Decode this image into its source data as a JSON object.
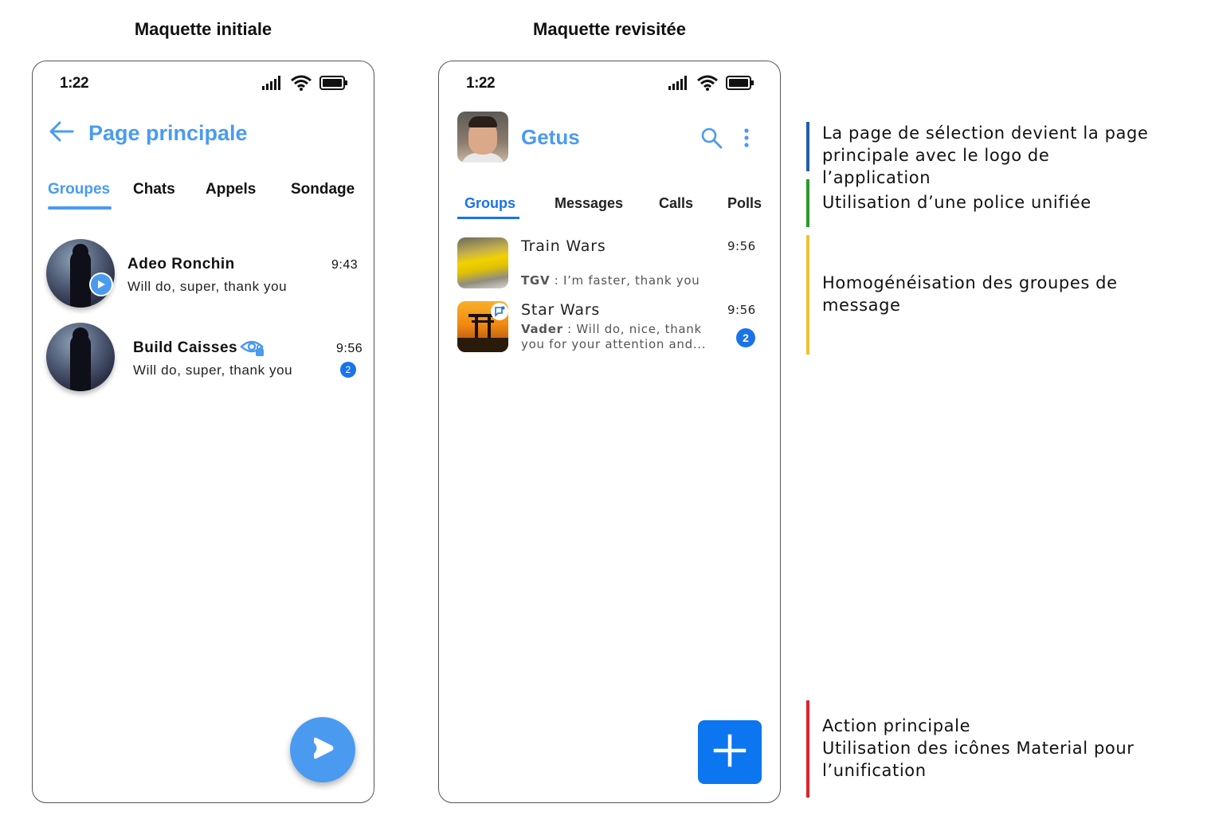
{
  "titles": {
    "left": "Maquette initiale",
    "right": "Maquette revisitée"
  },
  "left_phone": {
    "status_time": "1:22",
    "header_title": "Page principale",
    "tabs": [
      "Groupes",
      "Chats",
      "Appels",
      "Sondage"
    ],
    "rows": [
      {
        "name": "Adeo Ronchin",
        "message": "Will do, super, thank you",
        "time": "9:43"
      },
      {
        "name": "Build Caisses",
        "message": "Will do, super, thank you",
        "time": "9:56",
        "unread": "2"
      }
    ]
  },
  "right_phone": {
    "status_time": "1:22",
    "app_name": "Getus",
    "tabs": [
      "Groups",
      "Messages",
      "Calls",
      "Polls"
    ],
    "rows": [
      {
        "name": "Train Wars",
        "time": "9:56",
        "sender": "TGV",
        "separator": " : ",
        "message": "I’m faster, thank you"
      },
      {
        "name": "Star Wars",
        "time": "9:56",
        "sender": "Vader",
        "separator": " : ",
        "message_line1": "Will do, nice, thank",
        "message_line2": "you for your attention and...",
        "unread": "2"
      }
    ]
  },
  "notes": [
    {
      "color": "#1f5fa8",
      "lines": [
        "La page de sélection devient la page",
        "principale avec le logo de",
        "l’application"
      ]
    },
    {
      "color": "#2a9a2a",
      "lines": [
        "Utilisation d’une police unifiée"
      ]
    },
    {
      "color": "#f0c233",
      "lines": [
        "Homogénéisation des groupes de",
        "message"
      ]
    },
    {
      "color": "#e0232a",
      "lines": [
        "Action principale",
        "Utilisation des icônes Material pour",
        "l’unification"
      ]
    }
  ],
  "colors": {
    "accent_left": "#4a9bf0",
    "accent_right": "#1a73e8",
    "fab_right": "#0b76f0"
  },
  "icons": [
    "signal-icon",
    "wifi-icon",
    "battery-icon",
    "back-arrow-icon",
    "play-icon",
    "eye-lock-icon",
    "search-icon",
    "more-vert-icon",
    "chat-badge-icon",
    "add-icon"
  ]
}
